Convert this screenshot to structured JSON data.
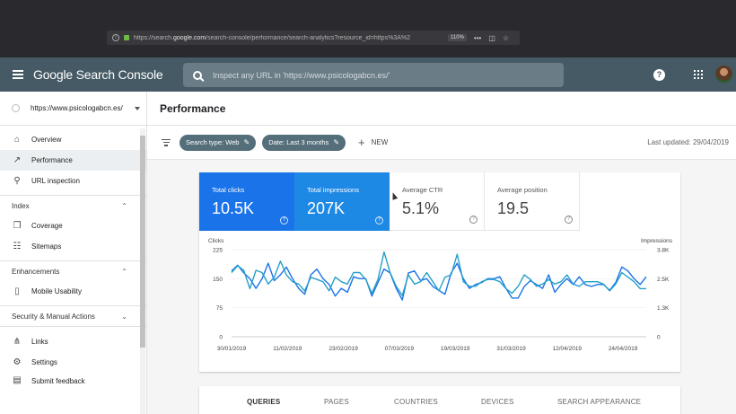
{
  "browser": {
    "url_prefix": "https://search.",
    "url_host": "google.com",
    "url_rest": "/search-console/performance/search-analytics?resource_id=https%3A%2",
    "zoom": "110%",
    "more_label": "•••"
  },
  "header": {
    "brand": "Google Search Console",
    "search_placeholder": "Inspect any URL in 'https://www.psicologabcn.es/'"
  },
  "sidebar": {
    "property": "https://www.psicologabcn.es/",
    "items_top": [
      {
        "label": "Overview",
        "icon": "home-icon"
      },
      {
        "label": "Performance",
        "icon": "trend-icon"
      },
      {
        "label": "URL inspection",
        "icon": "search-icon"
      }
    ],
    "index_section": "Index",
    "index_items": [
      {
        "label": "Coverage",
        "icon": "copy-icon"
      },
      {
        "label": "Sitemaps",
        "icon": "sitemap-icon"
      }
    ],
    "enhancements_section": "Enhancements",
    "enhancement_items": [
      {
        "label": "Mobile Usability",
        "icon": "phone-icon"
      }
    ],
    "security_section": "Security & Manual Actions",
    "bottom_items": [
      {
        "label": "Links",
        "icon": "links-icon"
      },
      {
        "label": "Settings",
        "icon": "gear-icon"
      }
    ],
    "cut_item": "Submit feedback"
  },
  "main": {
    "title": "Performance",
    "chips": [
      "Search type: Web",
      "Date: Last 3 months"
    ],
    "new_label": "NEW",
    "last_updated": "Last updated: 29/04/2019",
    "metrics": [
      {
        "label": "Total clicks",
        "value": "10.5K"
      },
      {
        "label": "Total impressions",
        "value": "207K"
      },
      {
        "label": "Average CTR",
        "value": "5.1%"
      },
      {
        "label": "Average position",
        "value": "19.5"
      }
    ],
    "tabs": [
      "QUERIES",
      "PAGES",
      "COUNTRIES",
      "DEVICES",
      "SEARCH APPEARANCE"
    ]
  },
  "chart_data": {
    "type": "line",
    "ylabel_left": "Clicks",
    "ylabel_right": "Impressions",
    "left_ticks": [
      "225",
      "150",
      "75",
      "0"
    ],
    "right_ticks": [
      "3.8K",
      "2.5K",
      "1.3K",
      "0"
    ],
    "x_ticks": [
      "30/01/2019",
      "11/02/2019",
      "23/02/2019",
      "07/03/2019",
      "19/03/2019",
      "31/03/2019",
      "12/04/2019",
      "24/04/2019"
    ],
    "ylim_left": [
      0,
      225
    ],
    "ylim_right": [
      0,
      3800
    ],
    "series": [
      {
        "color": "#1a73e8",
        "axis": "left",
        "values": [
          170,
          185,
          165,
          150,
          125,
          150,
          190,
          145,
          160,
          180,
          150,
          125,
          110,
          160,
          175,
          150,
          135,
          105,
          125,
          115,
          155,
          150,
          150,
          105,
          140,
          175,
          165,
          125,
          95,
          165,
          170,
          145,
          150,
          130,
          120,
          110,
          165,
          190,
          150,
          125,
          135,
          140,
          150,
          150,
          155,
          125,
          100,
          100,
          130,
          145,
          135,
          125,
          160,
          115,
          135,
          150,
          135,
          155,
          135,
          130,
          135,
          135,
          120,
          140,
          180,
          170,
          150,
          135,
          155
        ]
      },
      {
        "color": "#26a0c8",
        "axis": "right",
        "values": [
          2800,
          3100,
          2900,
          2100,
          2900,
          2800,
          2300,
          2600,
          3300,
          2700,
          2400,
          2300,
          2000,
          2600,
          2500,
          2400,
          2000,
          2600,
          2400,
          2300,
          2800,
          2800,
          2500,
          1900,
          2500,
          3700,
          2800,
          2200,
          1800,
          2700,
          2300,
          2400,
          2800,
          2400,
          2000,
          2600,
          2700,
          3600,
          2400,
          2200,
          2200,
          2400,
          2500,
          2500,
          2400,
          2100,
          1900,
          2200,
          2700,
          2500,
          2200,
          2300,
          2500,
          2300,
          2400,
          2700,
          2300,
          2200,
          2400,
          2400,
          2400,
          2300,
          2000,
          2300,
          2800,
          2600,
          2400,
          2100,
          2100
        ]
      }
    ]
  }
}
